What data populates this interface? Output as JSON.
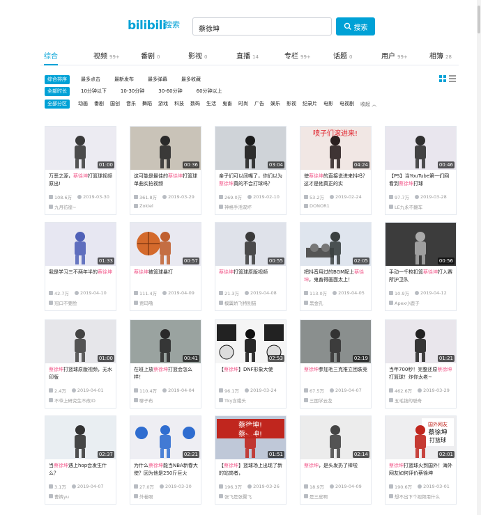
{
  "header": {
    "logo": "bilibili",
    "logo_sub": "搜索",
    "search_value": "蔡徐坤",
    "search_button": "搜索",
    "accent_color": "#00a1d6",
    "highlight_color": "#f25d8e"
  },
  "tabs": [
    {
      "label": "综合",
      "count": ""
    },
    {
      "label": "视频",
      "count": "99+"
    },
    {
      "label": "番剧",
      "count": "0"
    },
    {
      "label": "影视",
      "count": "0"
    },
    {
      "label": "直播",
      "count": "14"
    },
    {
      "label": "专栏",
      "count": "99+"
    },
    {
      "label": "话题",
      "count": "0"
    },
    {
      "label": "用户",
      "count": "99+"
    },
    {
      "label": "相簿",
      "count": "28"
    }
  ],
  "filters": {
    "order": [
      "综合排序",
      "最多点击",
      "最新发布",
      "最多弹幕",
      "最多收藏"
    ],
    "duration": [
      "全部时长",
      "10分钟以下",
      "10-30分钟",
      "30-60分钟",
      "60分钟以上"
    ],
    "zones": [
      "全部分区",
      "动画",
      "番剧",
      "国创",
      "音乐",
      "舞蹈",
      "游戏",
      "科技",
      "数码",
      "生活",
      "鬼畜",
      "时尚",
      "广告",
      "娱乐",
      "影视",
      "纪录片",
      "电影",
      "电视剧"
    ],
    "collapse_label": "收起"
  },
  "videos": [
    {
      "dur": "01:00",
      "pre": "万恶之源，",
      "hl": "蔡徐坤",
      "post": "打篮球视频原出!",
      "views": "108.6万",
      "date": "2019-03-30",
      "up": "九月彷徨~",
      "theme": "a"
    },
    {
      "dur": "00:36",
      "pre": "这可能是最佳的",
      "hl": "蔡徐坤",
      "post": "打篮球单曲实拍视频",
      "views": "361.8万",
      "date": "2019-03-29",
      "up": "Zokiel",
      "theme": "b"
    },
    {
      "dur": "03:04",
      "pre": "亲子们可以闭嘴了，你们以为",
      "hl": "蔡徐坤",
      "post": "真的不会打球吗？",
      "views": "269.0万",
      "date": "2019-02-10",
      "up": "神格手活双坏",
      "theme": "c"
    },
    {
      "dur": "04:24",
      "pre": "使",
      "hl": "蔡徐坤",
      "post": "的直接说进来抖吗？这才是他真正的实",
      "views": "53.2万",
      "date": "2019-02-24",
      "up": "DONOR1",
      "theme": "d"
    },
    {
      "dur": "00:46",
      "pre": "【PS】当YouTube第一们网看到",
      "hl": "蔡徐坤",
      "post": "打球",
      "views": "97.7万",
      "date": "2019-03-28",
      "up": "LE九永不翻车",
      "theme": "e"
    },
    {
      "dur": "01:33",
      "pre": "我是学习三不两年半的",
      "hl": "蔡徐坤",
      "post": "",
      "views": "42.7万",
      "date": "2019-04-10",
      "up": "冠口不要脸",
      "theme": "f"
    },
    {
      "dur": "00:57",
      "pre": "",
      "hl": "蔡徐坤",
      "post": "被篮球暴打",
      "views": "111.4万",
      "date": "2019-04-09",
      "up": "贾玛噜",
      "theme": "g"
    },
    {
      "dur": "00:55",
      "pre": "",
      "hl": "蔡徐坤",
      "post": "打篮球原版视频",
      "views": "21.3万",
      "date": "2019-04-08",
      "up": "模翼娇飞特别猫",
      "theme": "h"
    },
    {
      "dur": "02:05",
      "pre": "把抖音用过的BGM配上",
      "hl": "蔡徐坤",
      "post": "，鬼畜得画面太上！",
      "views": "113.0万",
      "date": "2019-04-05",
      "up": "黑金孔",
      "theme": "i"
    },
    {
      "dur": "00:56",
      "pre": "手动一千枚扣篮",
      "hl": "蔡徐坤",
      "post": "打入赛所护卫队",
      "views": "10.9万",
      "date": "2019-04-12",
      "up": "Apex小鹿子",
      "theme": "j"
    },
    {
      "dur": "01:00",
      "pre": "",
      "hl": "蔡徐坤",
      "post": "打篮球原版视频，无水印版",
      "views": "2.4万",
      "date": "2019-04-01",
      "up": "不爷上研究生不改ID",
      "theme": "k"
    },
    {
      "dur": "00:41",
      "pre": "在班上放",
      "hl": "蔡徐坤",
      "post": "打篮会怎么样！",
      "views": "110.4万",
      "date": "2019-04-04",
      "up": "聊子布",
      "theme": "l"
    },
    {
      "dur": "02:53",
      "pre": "【",
      "hl": "蔡徐坤",
      "post": "】DNF形象大使",
      "views": "96.1万",
      "date": "2019-03-24",
      "up": "Tky含蛾头",
      "theme": "m"
    },
    {
      "dur": "02:19",
      "pre": "",
      "hl": "蔡徐坤",
      "post": "参加毛三克推立团装竞",
      "views": "67.5万",
      "date": "2019-04-07",
      "up": "三国学云龙",
      "theme": "n"
    },
    {
      "dur": "01:21",
      "pre": "当年700秒！完整还原",
      "hl": "蔡徐坤",
      "post": "打篮球！炸你太老~",
      "views": "462.6万",
      "date": "2019-03-29",
      "up": "五毛钱的聪奇",
      "theme": "o"
    },
    {
      "dur": "02:37",
      "pre": "当",
      "hl": "蔡徐坤",
      "post": "遇上hop会发生什么？",
      "views": "3.1万",
      "date": "2019-04-07",
      "up": "曹裤yu",
      "theme": "p"
    },
    {
      "dur": "02:21",
      "pre": "为什么",
      "hl": "蔡徐坤",
      "post": "能当NBA新春大使？因为他是250斤巨火",
      "views": "27.0万",
      "date": "2019-03-30",
      "up": "外卷眼",
      "theme": "q"
    },
    {
      "dur": "01:51",
      "pre": "【",
      "hl": "蔡徐坤",
      "post": "】篮球场上出现了新的站岗者，",
      "views": "196.3万",
      "date": "2019-03-26",
      "up": "张飞是张翼飞",
      "theme": "r"
    },
    {
      "dur": "02:14",
      "pre": "",
      "hl": "蔡徐坤",
      "post": "，是头发扔了棒啦",
      "views": "18.9万",
      "date": "2019-04-09",
      "up": "是三皮啊",
      "theme": "s"
    },
    {
      "dur": "02:01",
      "pre": "",
      "hl": "蔡徐坤",
      "post": "打篮球火到国外！海外网友如何评价蔡徐坤",
      "views": "190.6万",
      "date": "2019-03-01",
      "up": "想不出下个视频用什么",
      "theme": "t"
    }
  ]
}
